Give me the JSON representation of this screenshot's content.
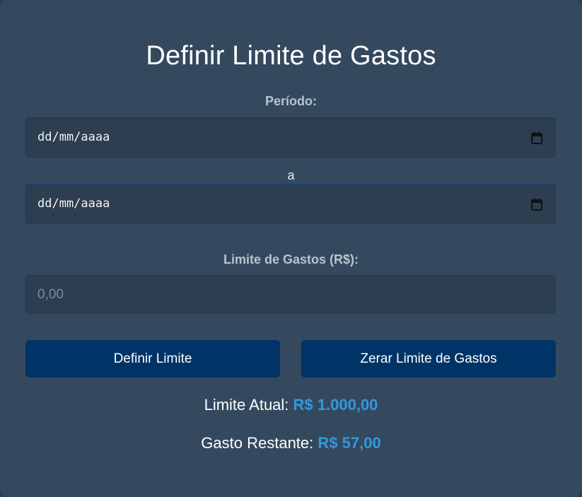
{
  "title": "Definir Limite de Gastos",
  "period": {
    "label": "Período:",
    "start_placeholder": "dd/mm/aaaa",
    "separator": "a",
    "end_placeholder": "dd/mm/aaaa",
    "icon": "calendar-icon"
  },
  "limit_field": {
    "label": "Limite de Gastos (R$):",
    "placeholder": "0,00"
  },
  "buttons": {
    "set_limit": "Definir Limite",
    "reset_limit": "Zerar Limite de Gastos"
  },
  "summary": {
    "current_limit_label": "Limite Atual:",
    "current_limit_value": "R$ 1.000,00",
    "remaining_label": "Gasto Restante:",
    "remaining_value": "R$ 57,00"
  },
  "colors": {
    "background": "#34495e",
    "button": "#003366",
    "accent_value": "#3498db",
    "input_bg": "#2c3e50",
    "input_border": "#0e3c74"
  }
}
